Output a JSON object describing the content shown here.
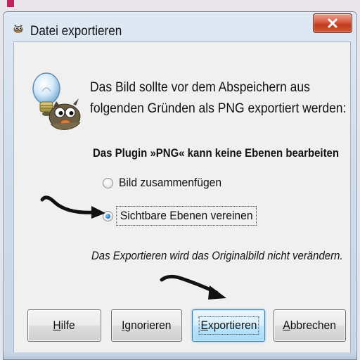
{
  "window": {
    "title": "Datei exportieren",
    "title_icon": "gimp-wilber-icon",
    "close_glyph": "close-icon"
  },
  "dialog": {
    "icon": "gimp-lightbulb-wilber-icon",
    "message_line1": "Das Bild sollte vor dem Abspeichern aus",
    "message_line2": "folgenden Gründen als PNG exportiert werden:",
    "plugin_note": "Das Plugin »PNG« kann keine Ebenen bearbeiten",
    "options": [
      {
        "label": "Bild zusammenfügen",
        "selected": false
      },
      {
        "label": "Sichtbare Ebenen vereinen",
        "selected": true
      }
    ],
    "info_note": "Das Exportieren wird das Originalbild nicht verändern."
  },
  "buttons": {
    "help": "Hilfe",
    "ignore": "Ignorieren",
    "export": "Exportieren",
    "cancel": "Abbrechen"
  },
  "annotations": {
    "arrow_color": "#111111"
  },
  "colors": {
    "close_button": "#c23a1e",
    "default_button_border": "#3c7fb1",
    "radio_selected": "#2b78c4"
  }
}
